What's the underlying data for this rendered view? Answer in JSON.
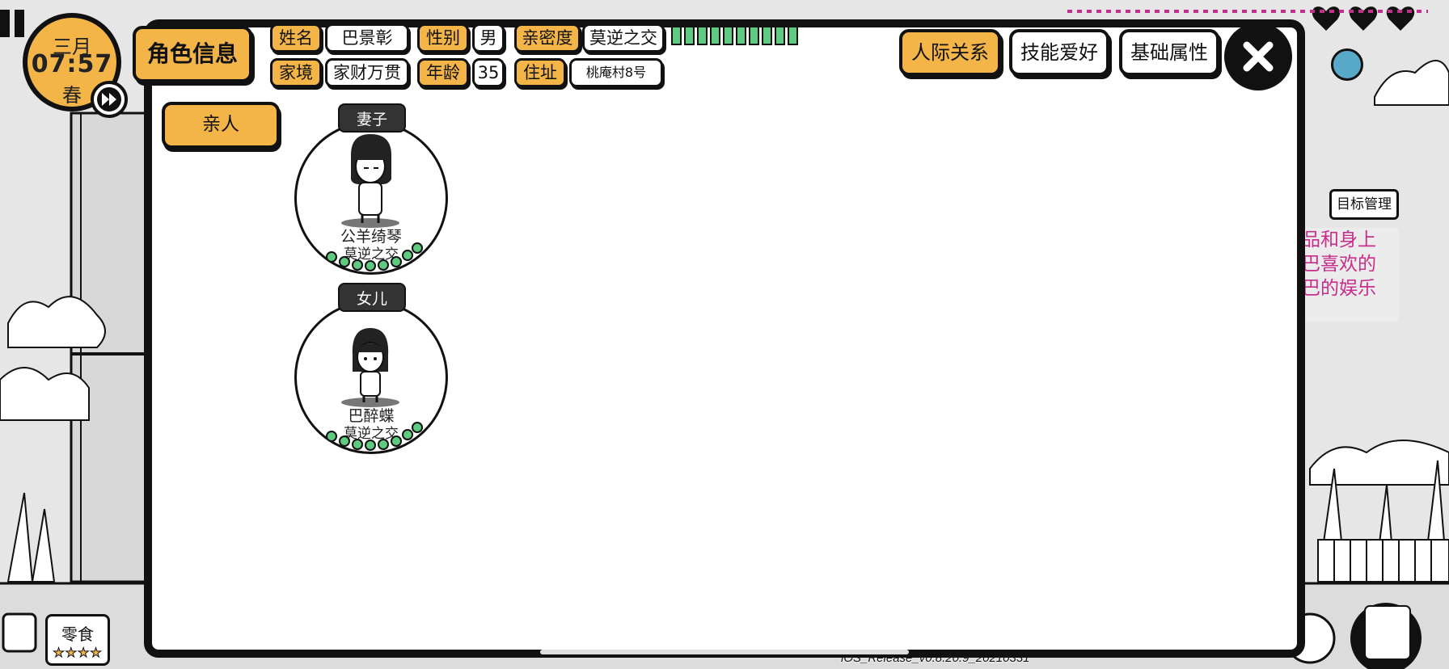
{
  "hud": {
    "month": "三月",
    "time": "07:57",
    "season": "春",
    "snack_label": "零食",
    "snack_stars": "★★★★",
    "goal_button": "目标管理",
    "side_hint": "品和身上\n巴喜欢的\n巴的娱乐",
    "build": "iOS_Release_v0.8.20.9_20210331"
  },
  "panel": {
    "title": "角色信息",
    "fields": {
      "name_label": "姓名",
      "name_value": "巴景彰",
      "gender_label": "性别",
      "gender_value": "男",
      "intimacy_label": "亲密度",
      "intimacy_value": "莫逆之交",
      "family_label": "家境",
      "family_value": "家财万贯",
      "age_label": "年龄",
      "age_value": "35",
      "address_label": "住址",
      "address_value": "桃庵村8号"
    },
    "intimacy_fill": 1.0,
    "tabs": [
      "人际关系",
      "技能爱好",
      "基础属性"
    ],
    "active_tab": "人际关系",
    "category": "亲人",
    "relations": [
      {
        "role": "妻子",
        "name": "公羊绮琴",
        "level": "莫逆之交"
      },
      {
        "role": "女儿",
        "name": "巴醉蝶",
        "level": "莫逆之交"
      }
    ]
  },
  "colors": {
    "accent": "#f3b548",
    "progress": "#5fcb80",
    "outline": "#111111",
    "hint_text": "#c72d8a"
  }
}
